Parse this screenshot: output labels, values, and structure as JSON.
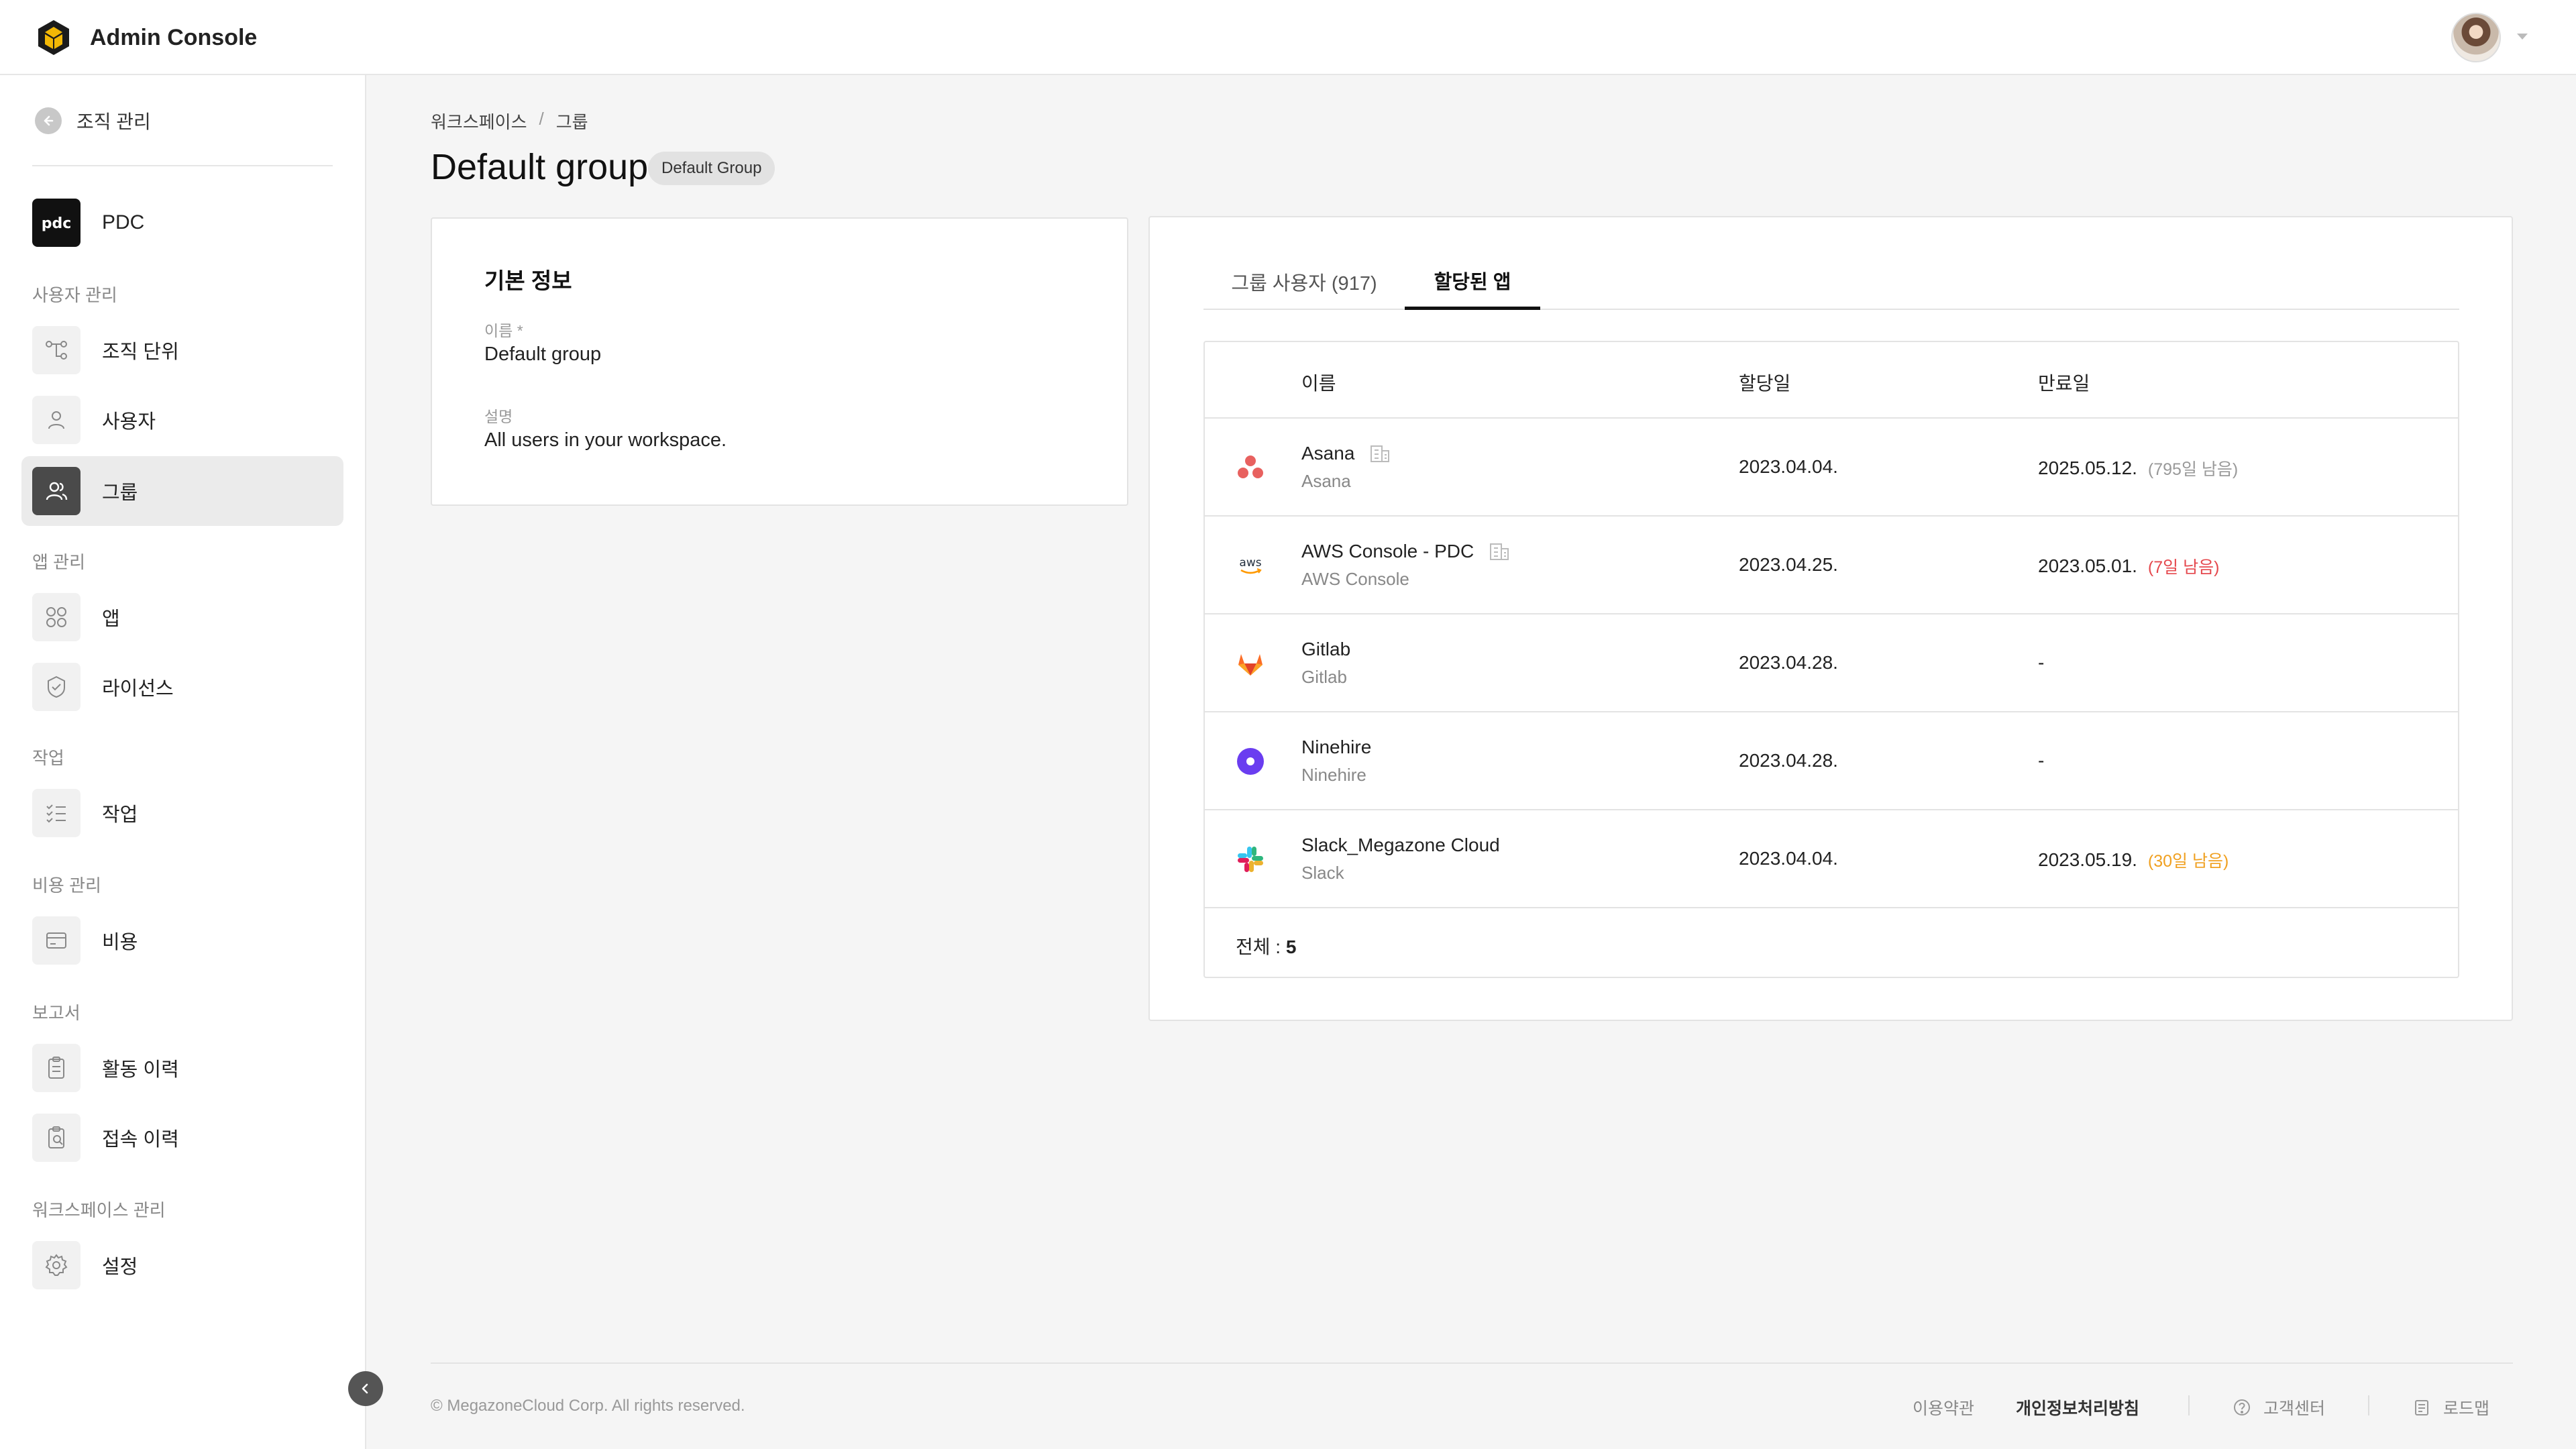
{
  "header": {
    "title": "Admin Console"
  },
  "sidebar": {
    "back_label": "조직 관리",
    "org_name": "PDC",
    "org_logo_text": "pdc",
    "sections": {
      "users": "사용자 관리",
      "apps": "앱 관리",
      "tasks": "작업",
      "cost": "비용 관리",
      "reports": "보고서",
      "workspace": "워크스페이스 관리"
    },
    "items": {
      "org_unit": "조직 단위",
      "users": "사용자",
      "groups": "그룹",
      "apps": "앱",
      "license": "라이선스",
      "tasks": "작업",
      "cost": "비용",
      "activity": "활동 이력",
      "access": "접속 이력",
      "settings": "설정"
    }
  },
  "breadcrumb": {
    "workspace": "워크스페이스",
    "separator": "/",
    "current": "그룹"
  },
  "page": {
    "title": "Default group",
    "badge": "Default Group"
  },
  "info": {
    "title": "기본 정보",
    "name_label": "이름 *",
    "name_value": "Default group",
    "desc_label": "설명",
    "desc_value": "All users in your workspace."
  },
  "tabs": {
    "members": "그룹 사용자 (917)",
    "apps": "할당된 앱"
  },
  "table": {
    "headers": {
      "name": "이름",
      "assigned": "할당일",
      "expires": "만료일"
    },
    "rows": [
      {
        "name": "Asana",
        "sub": "Asana",
        "assigned": "2023.04.04.",
        "expires": "2025.05.12.",
        "remain": "(795일 남음)"
      },
      {
        "name": "AWS Console - PDC",
        "sub": "AWS Console",
        "assigned": "2023.04.25.",
        "expires": "2023.05.01.",
        "remain": "(7일 남음)"
      },
      {
        "name": "Gitlab",
        "sub": "Gitlab",
        "assigned": "2023.04.28.",
        "expires": "-",
        "remain": ""
      },
      {
        "name": "Ninehire",
        "sub": "Ninehire",
        "assigned": "2023.04.28.",
        "expires": "-",
        "remain": ""
      },
      {
        "name": "Slack_Megazone Cloud",
        "sub": "Slack",
        "assigned": "2023.04.04.",
        "expires": "2023.05.19.",
        "remain": "(30일 남음)"
      }
    ],
    "total_label": "전체 :",
    "total_value": "5"
  },
  "footer": {
    "copyright": "© MegazoneCloud Corp. All rights reserved.",
    "terms": "이용약관",
    "privacy": "개인정보처리방침",
    "support": "고객센터",
    "roadmap": "로드맵"
  },
  "colors": {
    "accent": "#111111",
    "asana": "#e8615f",
    "ninehire": "#6a3df0",
    "gitlab": "#e24329",
    "warn_red": "#e5484d",
    "warn_orange": "#f0a020"
  }
}
